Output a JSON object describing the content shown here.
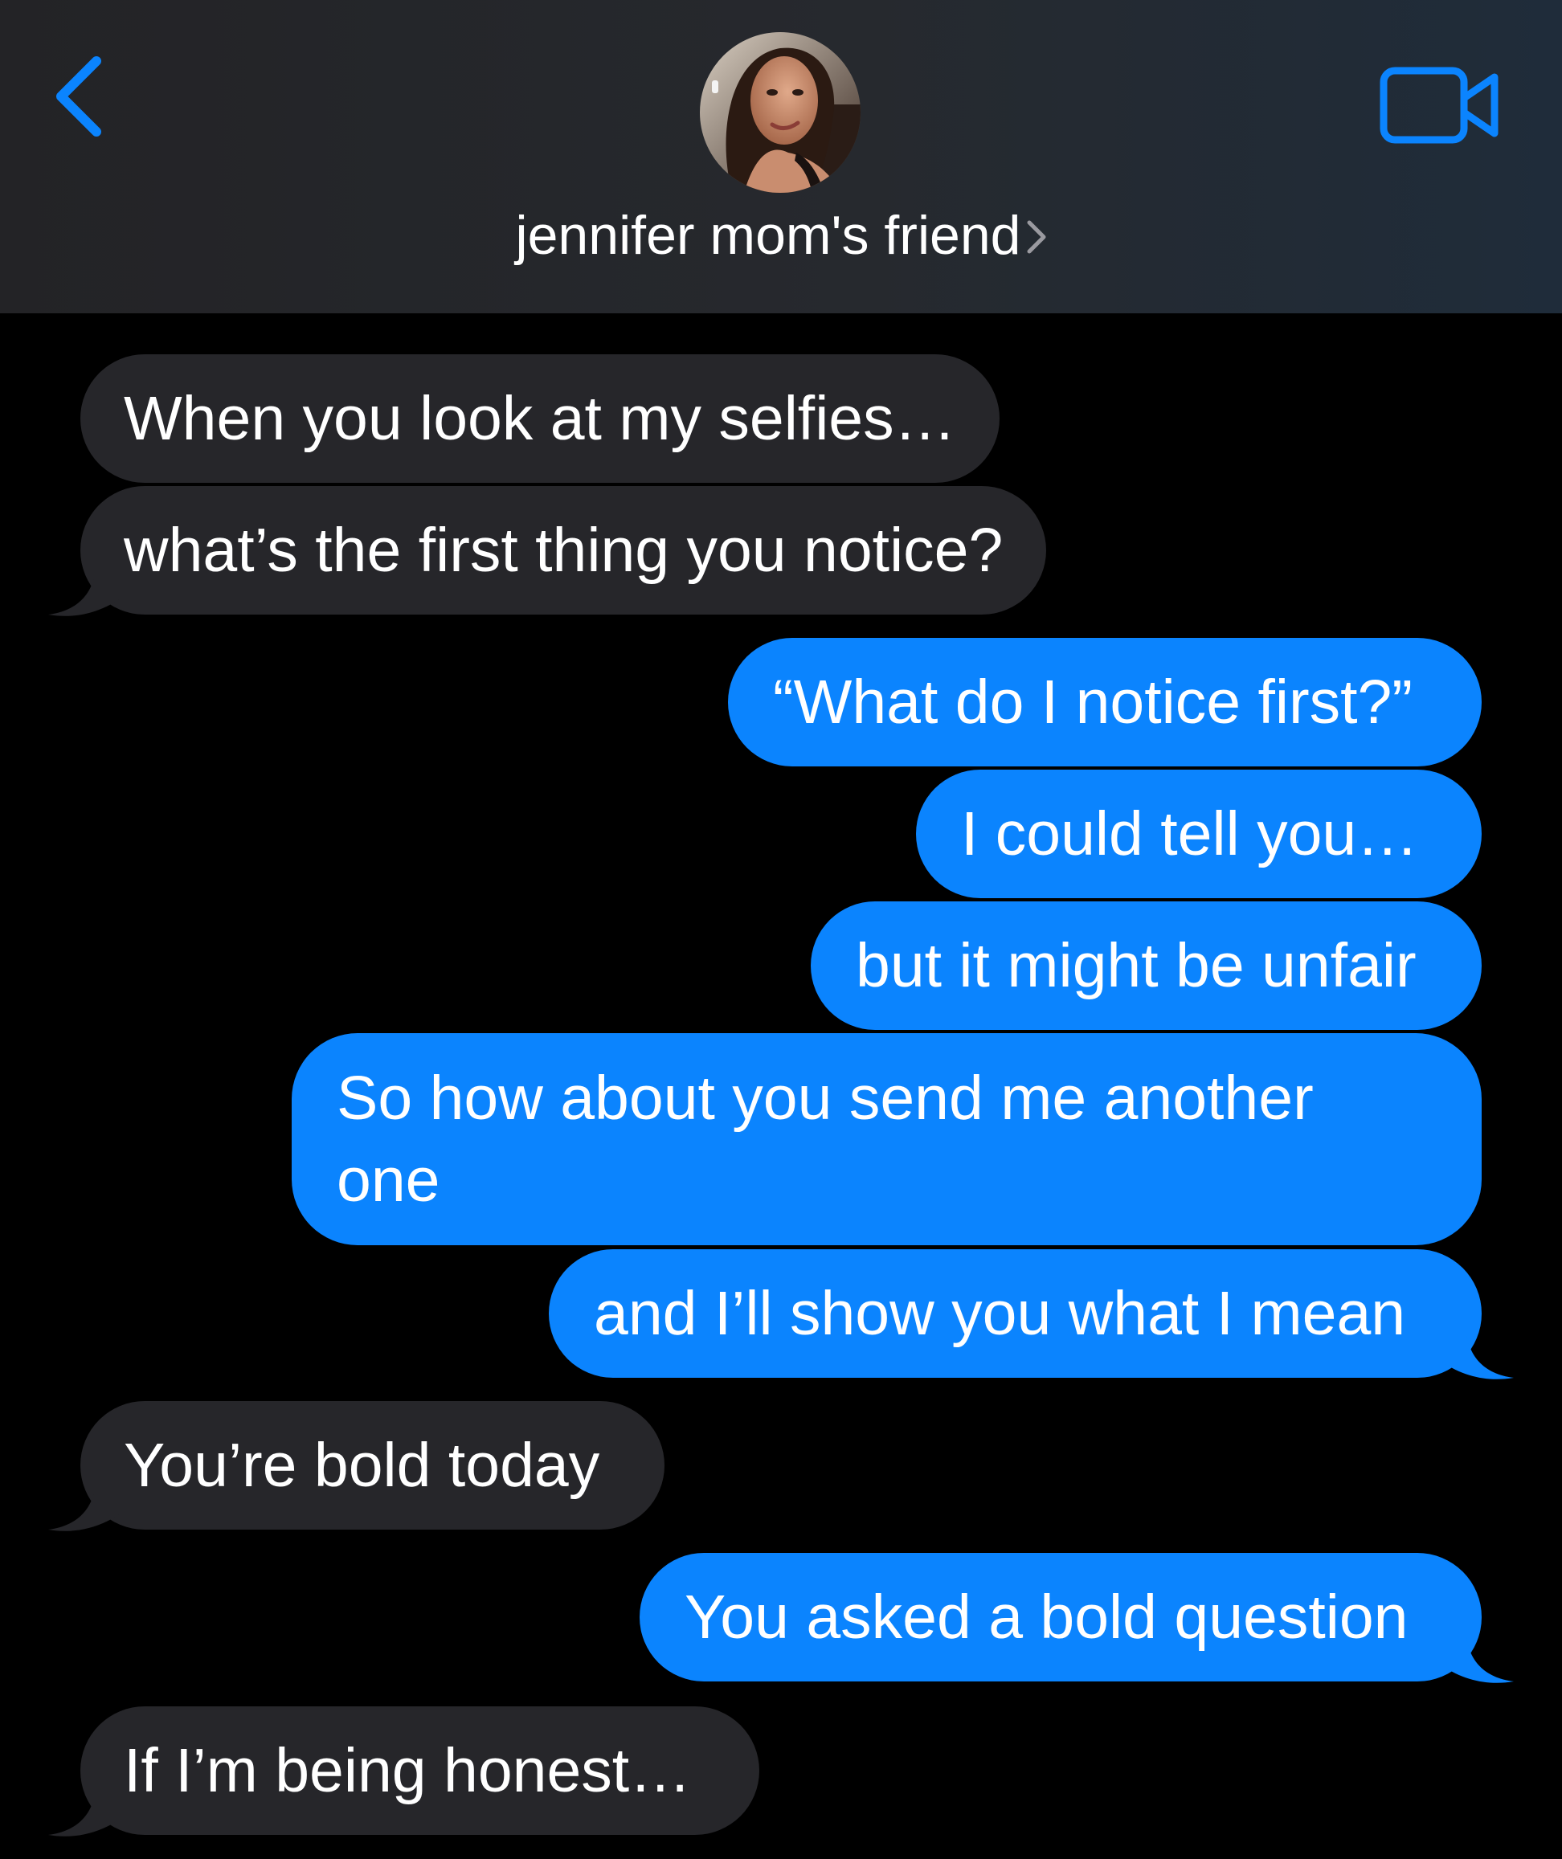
{
  "header": {
    "contact_name": "jennifer mom's friend",
    "back_icon": "chevron-left-icon",
    "video_icon": "video-camera-icon",
    "accent_color": "#0b84fe"
  },
  "messages": [
    {
      "direction": "incoming",
      "text": "When you look at my selfies…"
    },
    {
      "direction": "incoming",
      "text": "what’s the first thing you notice?"
    },
    {
      "direction": "outgoing",
      "text": "“What do I notice first?”"
    },
    {
      "direction": "outgoing",
      "text": "I could tell you…"
    },
    {
      "direction": "outgoing",
      "text": "but it might be unfair"
    },
    {
      "direction": "outgoing",
      "text": "So how about you send me another one"
    },
    {
      "direction": "outgoing",
      "text": "and I’ll show you what I mean"
    },
    {
      "direction": "incoming",
      "text": "You’re bold today"
    },
    {
      "direction": "outgoing",
      "text": "You asked a bold question"
    },
    {
      "direction": "incoming",
      "text": "If I’m being honest…"
    }
  ],
  "colors": {
    "incoming_bubble": "#26262a",
    "outgoing_bubble": "#0b84fe",
    "background": "#000000"
  }
}
